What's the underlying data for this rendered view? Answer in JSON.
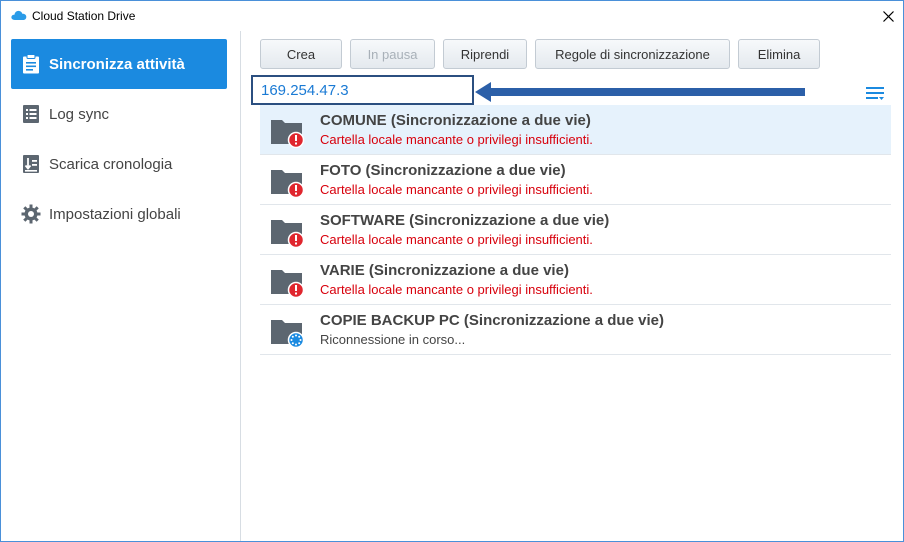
{
  "window": {
    "title": "Cloud Station Drive"
  },
  "sidebar": {
    "items": [
      {
        "label": "Sincronizza attività",
        "icon": "clipboard-icon",
        "active": true
      },
      {
        "label": "Log sync",
        "icon": "list-icon",
        "active": false
      },
      {
        "label": "Scarica cronologia",
        "icon": "download-history-icon",
        "active": false
      },
      {
        "label": "Impostazioni globali",
        "icon": "gear-icon",
        "active": false
      }
    ]
  },
  "toolbar": {
    "create_label": "Crea",
    "pause_label": "In pausa",
    "resume_label": "Riprendi",
    "rules_label": "Regole di sincronizzazione",
    "delete_label": "Elimina"
  },
  "annotation": {
    "ip_text": "169.254.47.3"
  },
  "tasks": [
    {
      "name": "COMUNE (Sincronizzazione a due vie)",
      "status": "Cartella locale mancante o privilegi insufficienti.",
      "state": "error"
    },
    {
      "name": "FOTO (Sincronizzazione a due vie)",
      "status": "Cartella locale mancante o privilegi insufficienti.",
      "state": "error"
    },
    {
      "name": "SOFTWARE (Sincronizzazione a due vie)",
      "status": "Cartella locale mancante o privilegi insufficienti.",
      "state": "error"
    },
    {
      "name": "VARIE (Sincronizzazione a due vie)",
      "status": "Cartella locale mancante o privilegi insufficienti.",
      "state": "error"
    },
    {
      "name": "COPIE BACKUP PC (Sincronizzazione a due vie)",
      "status": "Riconnessione in corso...",
      "state": "syncing"
    }
  ],
  "colors": {
    "accent": "#1b8ae0",
    "error": "#d8000c",
    "folder": "#5c6670",
    "selected_row": "#e6f2fc",
    "arrow": "#2b5fa8"
  }
}
